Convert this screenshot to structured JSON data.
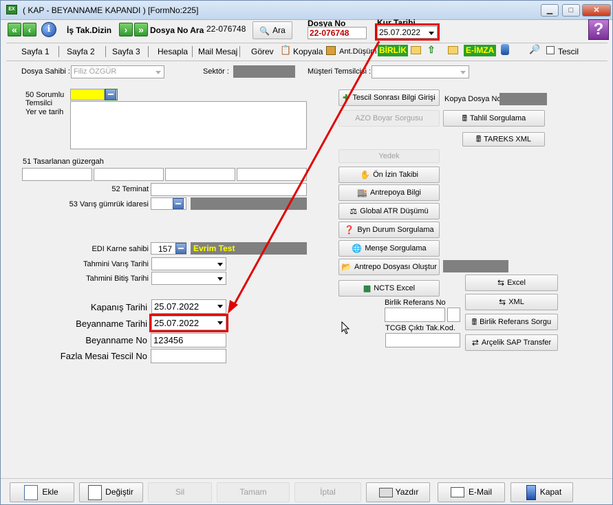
{
  "window": {
    "title": "( KAP - BEYANNAME  KAPANDI ) [FormNo:225]",
    "app_icon": "app-icon"
  },
  "toolbar": {
    "is_takip_label": "İş Tak.Dizin",
    "dosya_no_ara_label": "Dosya No Ara",
    "dosya_no_ara_value": "22-076748",
    "ara_button": "Ara",
    "dosya_no_label": "Dosya No",
    "dosya_no_value": "22-076748",
    "kur_tarihi_label": "Kur Tarihi",
    "kur_tarihi_value": "25.07.2022"
  },
  "tabs": [
    "Sayfa 1",
    "Sayfa 2",
    "Sayfa 3",
    "Hesapla",
    "Mail Mesaj",
    "Görev",
    "Kopyala",
    "Ant.Düşüm",
    "BİRLİK",
    "E-İMZA",
    "Tescil"
  ],
  "header": {
    "dosya_sahibi_label": "Dosya Sahibi :",
    "dosya_sahibi_value": "Filiz ÖZGÜR",
    "sektor_label": "Sektör :",
    "musteri_temsilcisi_label": "Müşteri Temsilcisi :"
  },
  "form": {
    "sorumlu_label": "50 Sorumlu Temsilci",
    "yer_tarih_label": "Yer ve tarih",
    "guzergah_label": "51 Tasarlanan güzergah",
    "teminat_label": "52 Teminat",
    "varis_gumruk_label": "53 Varış gümrük idaresi",
    "edi_karne_label": "EDI Karne sahibi",
    "edi_karne_code": "157",
    "edi_karne_name": "Evrim Test",
    "tahmini_varis_label": "Tahmini Varış Tarihi",
    "tahmini_bitis_label": "Tahmini Bitiş Tarihi",
    "kapanis_tarihi_label": "Kapanış Tarihi",
    "kapanis_tarihi_value": "25.07.2022",
    "beyanname_tarihi_label": "Beyanname Tarihi",
    "beyanname_tarihi_value": "25.07.2022",
    "beyanname_no_label": "Beyanname No",
    "beyanname_no_value": "123456",
    "fazla_mesai_label": "Fazla Mesai Tescil No"
  },
  "actions": {
    "tescil_sonrasi": "Tescil Sonrası Bilgi Girişi",
    "kopya_dosya_no": "Kopya Dosya No",
    "azo_boyar": "AZO Boyar Sorgusu",
    "tahlil_sorgulama": "Tahlil Sorgulama",
    "tareks_xml": "TAREKS XML",
    "yedek": "Yedek",
    "on_izin": "Ön İzin Takibi",
    "antrepoya_bilgi": "Antrepoya Bilgi",
    "global_atr": "Global ATR Düşümü",
    "byn_durum": "Byn Durum Sorgulama",
    "mense": "Menşe Sorgulama",
    "antrepo_olustur": "Antrepo Dosyası Oluştur",
    "ncts_excel": "NCTS Excel",
    "excel": "Excel",
    "xml": "XML",
    "birlik_ref_label": "Birlik Referans No",
    "birlik_ref_sorgu": "Birlik Referans Sorgu",
    "tcgb_label": "TCGB Çıktı Tak.Kod.",
    "arcelik_sap": "Arçelik SAP Transfer"
  },
  "bottom": {
    "ekle": "Ekle",
    "degistir": "Değiştir",
    "sil": "Sil",
    "tamam": "Tamam",
    "iptal": "İptal",
    "yazdir": "Yazdır",
    "email": "E-Mail",
    "kapat": "Kapat"
  },
  "colors": {
    "highlight": "#e10000",
    "accent_green": "#2ca02c",
    "dosya_no_text": "#c00000"
  }
}
